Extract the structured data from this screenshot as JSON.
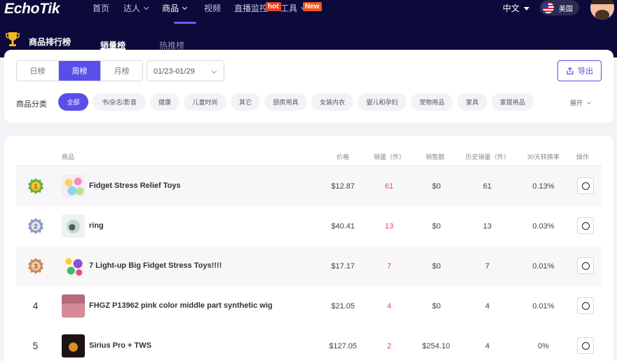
{
  "brand": {
    "logo": "EchoTik"
  },
  "nav": {
    "items": [
      {
        "label": "首页"
      },
      {
        "label": "达人"
      },
      {
        "label": "商品"
      },
      {
        "label": "视频"
      },
      {
        "label": "直播监控"
      },
      {
        "label": "工具"
      }
    ],
    "hot_badge": "hot",
    "new_badge": "New",
    "language": "中文",
    "region": "美国"
  },
  "subheader": {
    "title": "商品排行榜",
    "tabs": [
      {
        "label": "销量榜"
      },
      {
        "label": "热推榜"
      }
    ]
  },
  "filters": {
    "periods": [
      {
        "label": "日榜"
      },
      {
        "label": "周榜"
      },
      {
        "label": "月榜"
      }
    ],
    "date_range": "01/23-01/29",
    "export_label": "导出",
    "category_label": "商品分类",
    "categories": [
      {
        "label": "全部"
      },
      {
        "label": "书/杂志/影音"
      },
      {
        "label": "健康"
      },
      {
        "label": "儿童时尚"
      },
      {
        "label": "其它"
      },
      {
        "label": "厨房用具"
      },
      {
        "label": "女装内衣"
      },
      {
        "label": "婴儿和孕妇"
      },
      {
        "label": "宠物用品"
      },
      {
        "label": "家具"
      },
      {
        "label": "家居用品"
      }
    ],
    "expand_label": "展开"
  },
  "table": {
    "headers": {
      "product": "商品",
      "price": "价格",
      "sales": "销量（件）",
      "revenue": "销售额",
      "history": "历史销量（件）",
      "conversion": "30天转换率",
      "action": "操作"
    },
    "rows": [
      {
        "rank": "1",
        "medal": "gold",
        "name": "Fidget Stress Relief Toys",
        "price": "$12.87",
        "sales": "61",
        "revenue": "$0",
        "history": "61",
        "conversion": "0.13%"
      },
      {
        "rank": "2",
        "medal": "silver",
        "name": "ring",
        "price": "$40.41",
        "sales": "13",
        "revenue": "$0",
        "history": "13",
        "conversion": "0.03%"
      },
      {
        "rank": "3",
        "medal": "bronze",
        "name": "7 Light-up Big Fidget Stress Toys!!!!",
        "price": "$17.17",
        "sales": "7",
        "revenue": "$0",
        "history": "7",
        "conversion": "0.01%"
      },
      {
        "rank": "4",
        "medal": "",
        "name": "FHGZ P13962 pink color middle part synthetic wig",
        "price": "$21.05",
        "sales": "4",
        "revenue": "$0",
        "history": "4",
        "conversion": "0.01%"
      },
      {
        "rank": "5",
        "medal": "",
        "name": "Sirius Pro + TWS",
        "price": "$127.05",
        "sales": "2",
        "revenue": "$254.10",
        "history": "4",
        "conversion": "0%"
      }
    ]
  },
  "colors": {
    "nav_bg": "#0c0a3a",
    "accent": "#5a4ee8",
    "sales_pink": "#e0457b",
    "hot_badge": "#e8421e"
  }
}
